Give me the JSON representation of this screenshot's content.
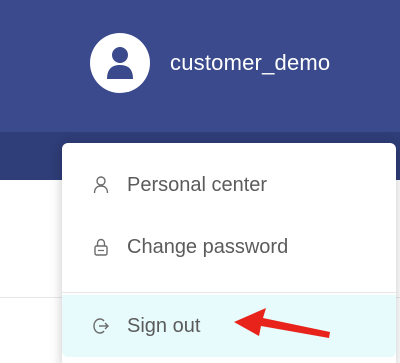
{
  "header": {
    "username": "customer_demo",
    "bg_color": "#3a4a8c",
    "avatar_icon": "user-icon"
  },
  "dropdown": {
    "items": [
      {
        "label": "Personal center",
        "icon": "person-icon"
      },
      {
        "label": "Change password",
        "icon": "lock-icon"
      },
      {
        "label": "Sign out",
        "icon": "logout-icon",
        "highlighted": true,
        "highlight_color": "#e8fbfc"
      }
    ]
  },
  "annotation": {
    "arrow_color": "#e8231b",
    "target": "Sign out"
  }
}
